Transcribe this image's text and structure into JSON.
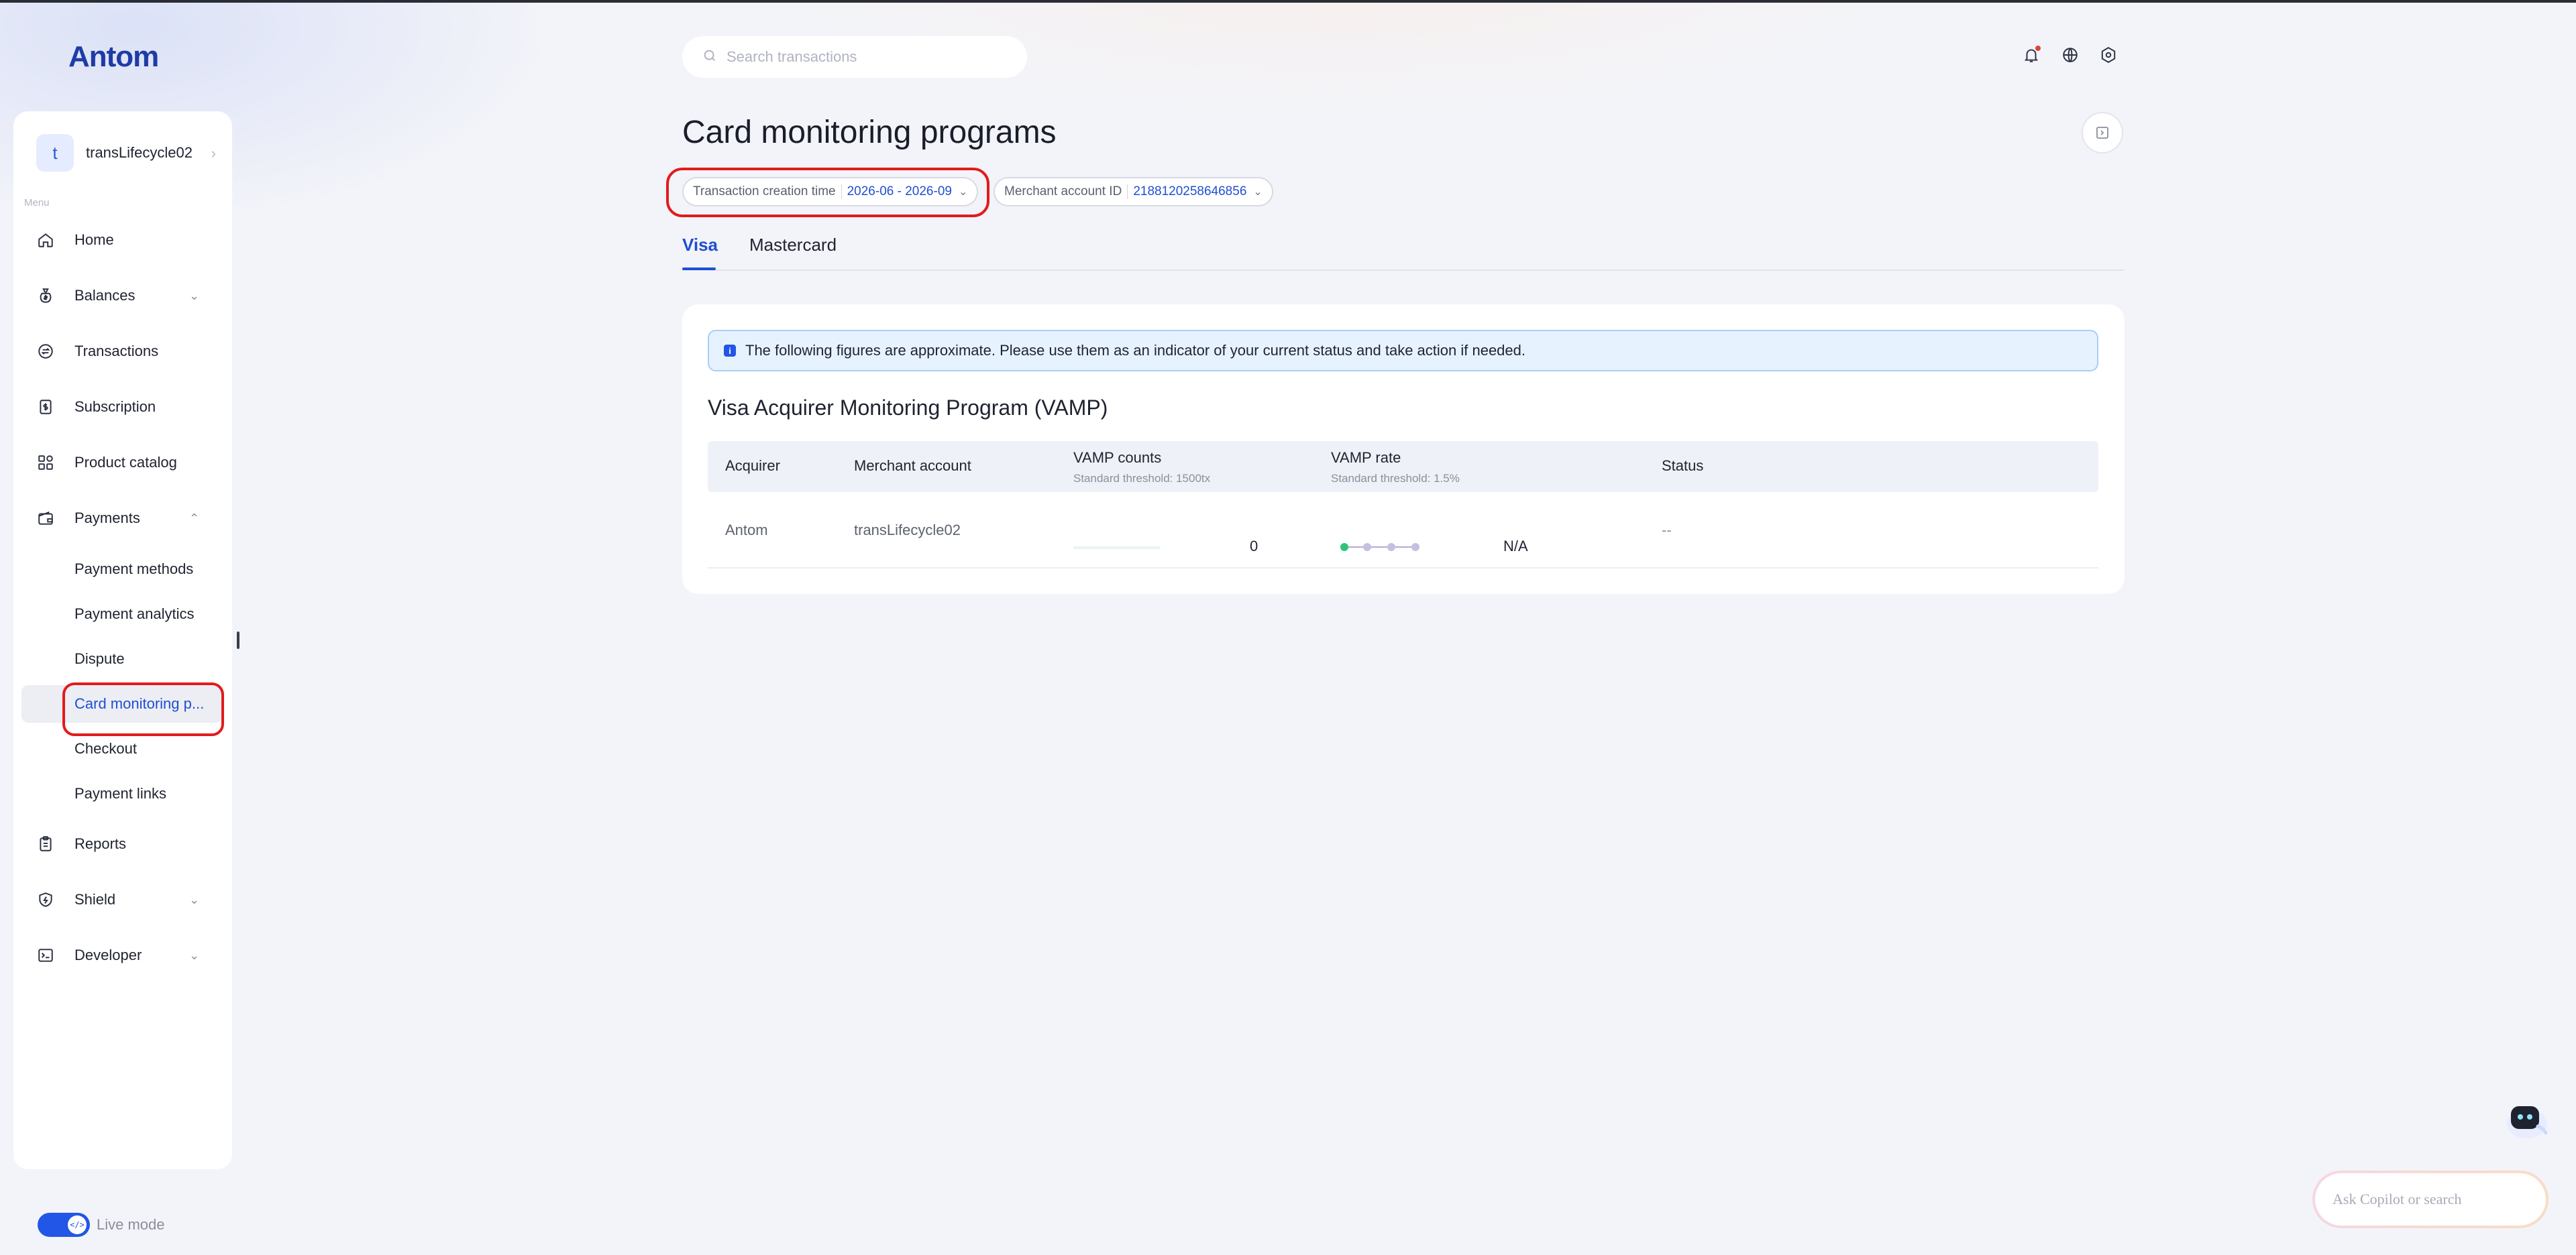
{
  "logo": {
    "text": "Antom"
  },
  "account": {
    "avatar_letter": "t",
    "name": "transLifecycle02"
  },
  "menu": {
    "caption": "Menu"
  },
  "sidebar": {
    "items": [
      {
        "label": "Home",
        "icon": "home-icon"
      },
      {
        "label": "Balances",
        "icon": "money-bag-icon"
      },
      {
        "label": "Transactions",
        "icon": "exchange-icon"
      },
      {
        "label": "Subscription",
        "icon": "dollar-doc-icon"
      },
      {
        "label": "Product catalog",
        "icon": "grid-icon"
      },
      {
        "label": "Payments",
        "icon": "wallet-icon"
      },
      {
        "label": "Reports",
        "icon": "clipboard-icon"
      },
      {
        "label": "Shield",
        "icon": "shield-icon"
      },
      {
        "label": "Developer",
        "icon": "terminal-icon"
      }
    ],
    "payments_sub": [
      {
        "label": "Payment methods"
      },
      {
        "label": "Payment analytics"
      },
      {
        "label": "Dispute"
      },
      {
        "label": "Card monitoring p..."
      },
      {
        "label": "Checkout"
      },
      {
        "label": "Payment links"
      }
    ]
  },
  "live_mode": {
    "label": "Live mode",
    "enabled": true
  },
  "search": {
    "placeholder": "Search transactions"
  },
  "page": {
    "title": "Card monitoring programs"
  },
  "filters": {
    "time": {
      "label": "Transaction creation time",
      "value": "2026-06 - 2026-09"
    },
    "merchant": {
      "label": "Merchant account ID",
      "value": "2188120258646856"
    }
  },
  "tabs": [
    {
      "label": "Visa",
      "active": true
    },
    {
      "label": "Mastercard",
      "active": false
    }
  ],
  "notice": {
    "text": "The following figures are approximate. Please use them as an indicator of your current status and take action if needed."
  },
  "section": {
    "title": "Visa Acquirer Monitoring Program (VAMP)"
  },
  "table": {
    "headers": {
      "acquirer": "Acquirer",
      "merchant": "Merchant account",
      "counts": "VAMP counts",
      "counts_sub": "Standard threshold: 1500tx",
      "rate": "VAMP rate",
      "rate_sub": "Standard threshold: 1.5%",
      "status": "Status"
    },
    "rows": [
      {
        "acquirer": "Antom",
        "merchant": "transLifecycle02",
        "counts": "0",
        "rate": "N/A",
        "status": "--"
      }
    ]
  },
  "copilot": {
    "placeholder": "Ask Copilot or search"
  },
  "colors": {
    "accent": "#1f4fd1",
    "highlight_ring": "#e31b1b",
    "toggle": "#2256e6"
  }
}
